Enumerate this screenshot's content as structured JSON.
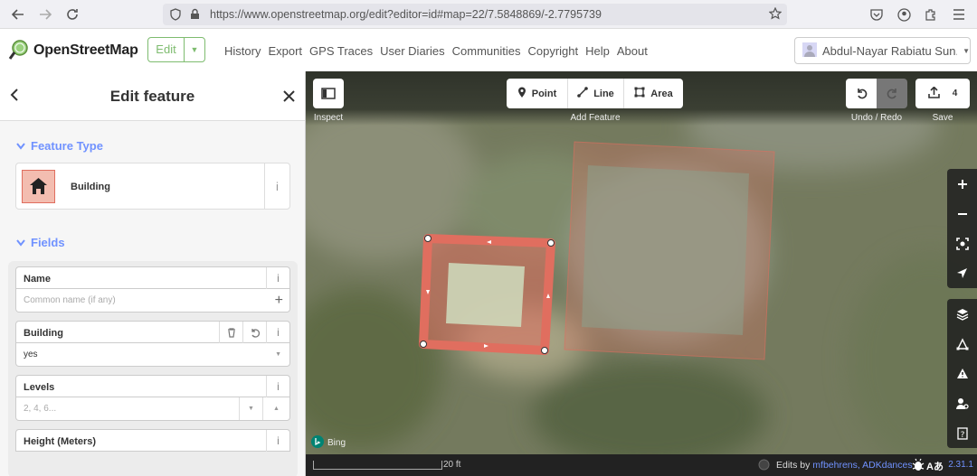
{
  "browser": {
    "url": "https://www.openstreetmap.org/edit?editor=id#map=22/7.5848869/-2.7795739"
  },
  "osm": {
    "logo_text": "OpenStreetMap",
    "edit_label": "Edit",
    "nav": [
      "History",
      "Export",
      "GPS Traces",
      "User Diaries",
      "Communities",
      "Copyright",
      "Help",
      "About"
    ],
    "user": "Abdul-Nayar Rabiatu Sun..."
  },
  "sidebar": {
    "title": "Edit feature",
    "feature_type_heading": "Feature Type",
    "preset_label": "Building",
    "fields_heading": "Fields",
    "fields": {
      "name": {
        "label": "Name",
        "placeholder": "Common name (if any)"
      },
      "building": {
        "label": "Building",
        "value": "yes"
      },
      "levels": {
        "label": "Levels",
        "placeholder": "2, 4, 6..."
      },
      "height": {
        "label": "Height (Meters)"
      }
    }
  },
  "map": {
    "inspect_label": "Inspect",
    "tools": {
      "point": "Point",
      "line": "Line",
      "area": "Area"
    },
    "add_feature_label": "Add Feature",
    "undo_redo_label": "Undo / Redo",
    "save_label": "Save",
    "save_count": "4",
    "bing_label": "Bing",
    "scale_label": "20 ft",
    "edits_prefix": "Edits by ",
    "edits_users": "mfbehrens, ADKdances",
    "version": "2.31.1"
  }
}
